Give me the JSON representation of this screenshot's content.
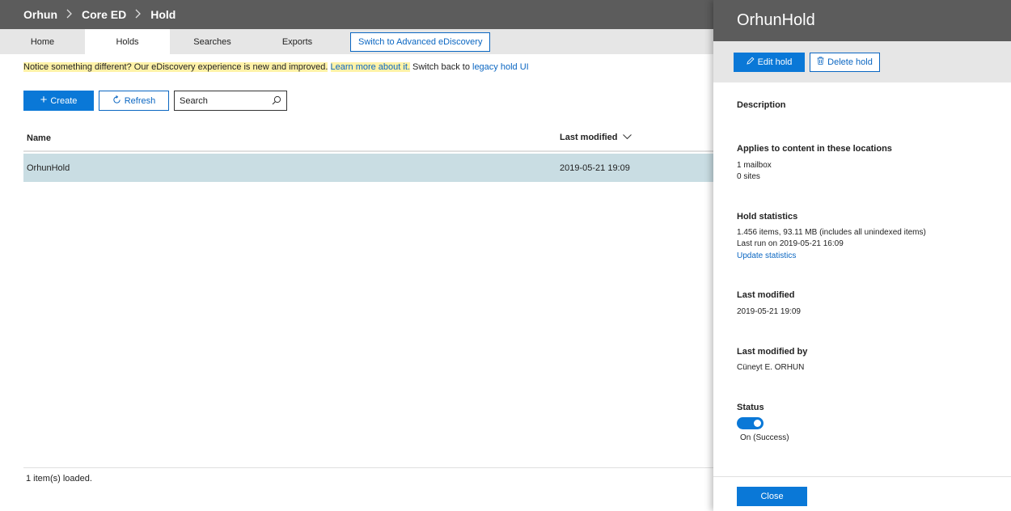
{
  "breadcrumb": [
    "Orhun",
    "Core ED",
    "Hold"
  ],
  "tabs": [
    {
      "label": "Home",
      "active": false
    },
    {
      "label": "Holds",
      "active": true
    },
    {
      "label": "Searches",
      "active": false
    },
    {
      "label": "Exports",
      "active": false
    }
  ],
  "switch_label": "Switch to Advanced eDiscovery",
  "notice": {
    "text": "Notice something different? Our eDiscovery experience is new and improved.",
    "learn_more": "Learn more about it.",
    "switch_back": "Switch back to",
    "legacy_link": "legacy hold UI"
  },
  "toolbar": {
    "create_label": "Create",
    "refresh_label": "Refresh",
    "search_placeholder": "Search"
  },
  "table": {
    "columns": {
      "name": "Name",
      "last_modified": "Last modified"
    },
    "rows": [
      {
        "name": "OrhunHold",
        "last_modified": "2019-05-21 19:09"
      }
    ]
  },
  "status_bar": "1 item(s) loaded.",
  "panel": {
    "title": "OrhunHold",
    "edit_label": "Edit hold",
    "delete_label": "Delete hold",
    "description_title": "Description",
    "locations_title": "Applies to content in these locations",
    "locations": [
      "1 mailbox",
      "0 sites"
    ],
    "stats_title": "Hold statistics",
    "stats_items": "1.456 items, 93.11 MB  (includes all unindexed items)",
    "stats_last_run": "Last run on 2019-05-21 16:09",
    "update_stats": "Update statistics",
    "last_modified_title": "Last modified",
    "last_modified": "2019-05-21 19:09",
    "last_modified_by_title": "Last modified by",
    "last_modified_by": "Cüneyt E. ORHUN",
    "status_title": "Status",
    "status_on": true,
    "status_text": "On (Success)",
    "close_label": "Close"
  },
  "colors": {
    "accent": "#0a78d7",
    "header": "#5c5c5c",
    "row_selected": "#c9dde3",
    "highlight": "#fff2a8"
  }
}
